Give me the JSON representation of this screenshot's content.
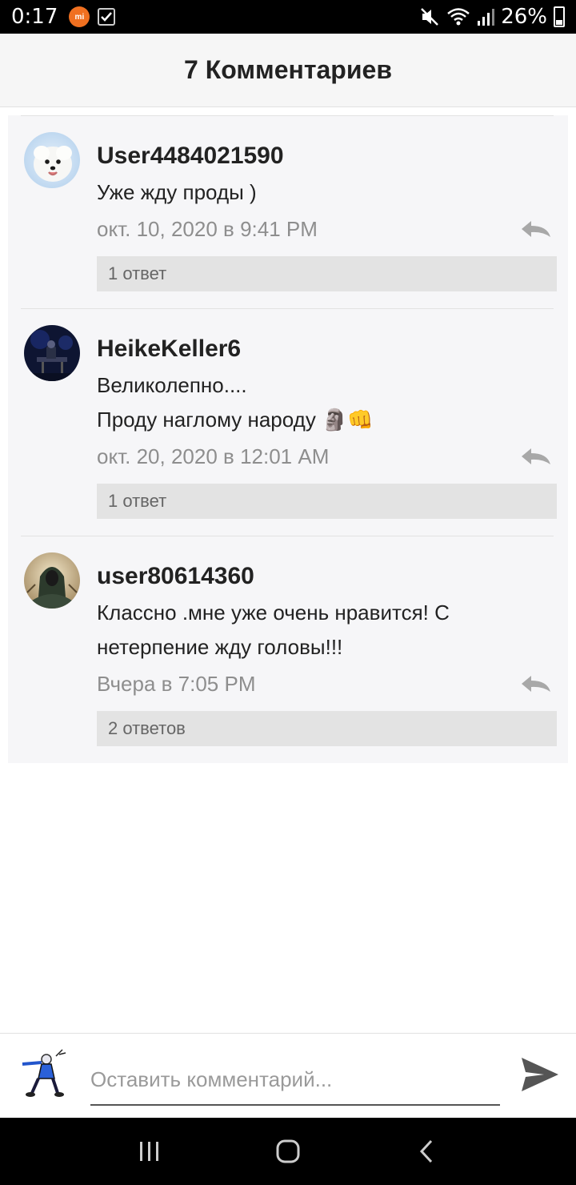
{
  "status": {
    "time": "0:17",
    "battery": "26%"
  },
  "header": {
    "title": "7 Комментариев"
  },
  "comments": [
    {
      "username": "User4484021590",
      "text": "Уже жду проды )",
      "date": "окт. 10, 2020 в 9:41 PM",
      "replies": "1 ответ",
      "avatar": "white-fluffy-dog-avatar"
    },
    {
      "username": "HeikeKeller6",
      "text": "Великолепно....\nПроду наглому народу 🗿👊",
      "date": "окт. 20, 2020 в 12:01 AM",
      "replies": "1 ответ",
      "avatar": "dark-night-scene-avatar"
    },
    {
      "username": "user80614360",
      "text": "Классно .мне уже очень нравится! С нетерпение жду головы!!!",
      "date": "Вчера в 7:05 PM",
      "replies": "2 ответов",
      "avatar": "hooded-figure-avatar"
    }
  ],
  "input": {
    "placeholder": "Оставить комментарий..."
  },
  "colors": {
    "header_bg": "#f6f6f6",
    "comment_bg": "#f6f6f8",
    "replies_bg": "#e3e3e3",
    "date_color": "#8e8e8e"
  }
}
